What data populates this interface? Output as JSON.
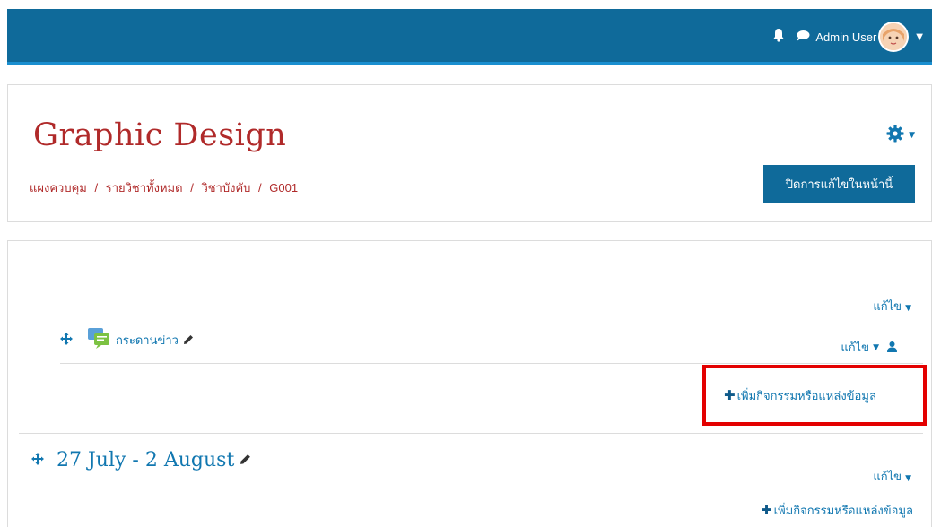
{
  "topbar": {
    "user_name": "Admin User",
    "icons": [
      "bell-icon",
      "chat-icon",
      "avatar",
      "caret-down-icon"
    ]
  },
  "header": {
    "title": "Graphic Design",
    "breadcrumb": [
      "แผงควบคุม",
      "รายวิชาทั้งหมด",
      "วิชาบังคับ",
      "G001"
    ],
    "breadcrumb_separator": "/",
    "edit_toggle_label": "ปิดการแก้ไขในหน้านี้"
  },
  "section0": {
    "edit_label": "แก้ไข",
    "activities": [
      {
        "name": "กระดานข่าว",
        "edit_label": "แก้ไข",
        "icon": "forum-icon"
      }
    ],
    "add_activity_label": "เพิ่มกิจกรรมหรือแหล่งข้อมูล"
  },
  "section1": {
    "title": "27 July - 2 August",
    "edit_label": "แก้ไข",
    "add_activity_label": "เพิ่มกิจกรรมหรือแหล่งข้อมูล"
  },
  "colors": {
    "navbar": "#0f6a9a",
    "title": "#b02a2a",
    "link": "#1177b0",
    "highlight": "#e30000"
  }
}
